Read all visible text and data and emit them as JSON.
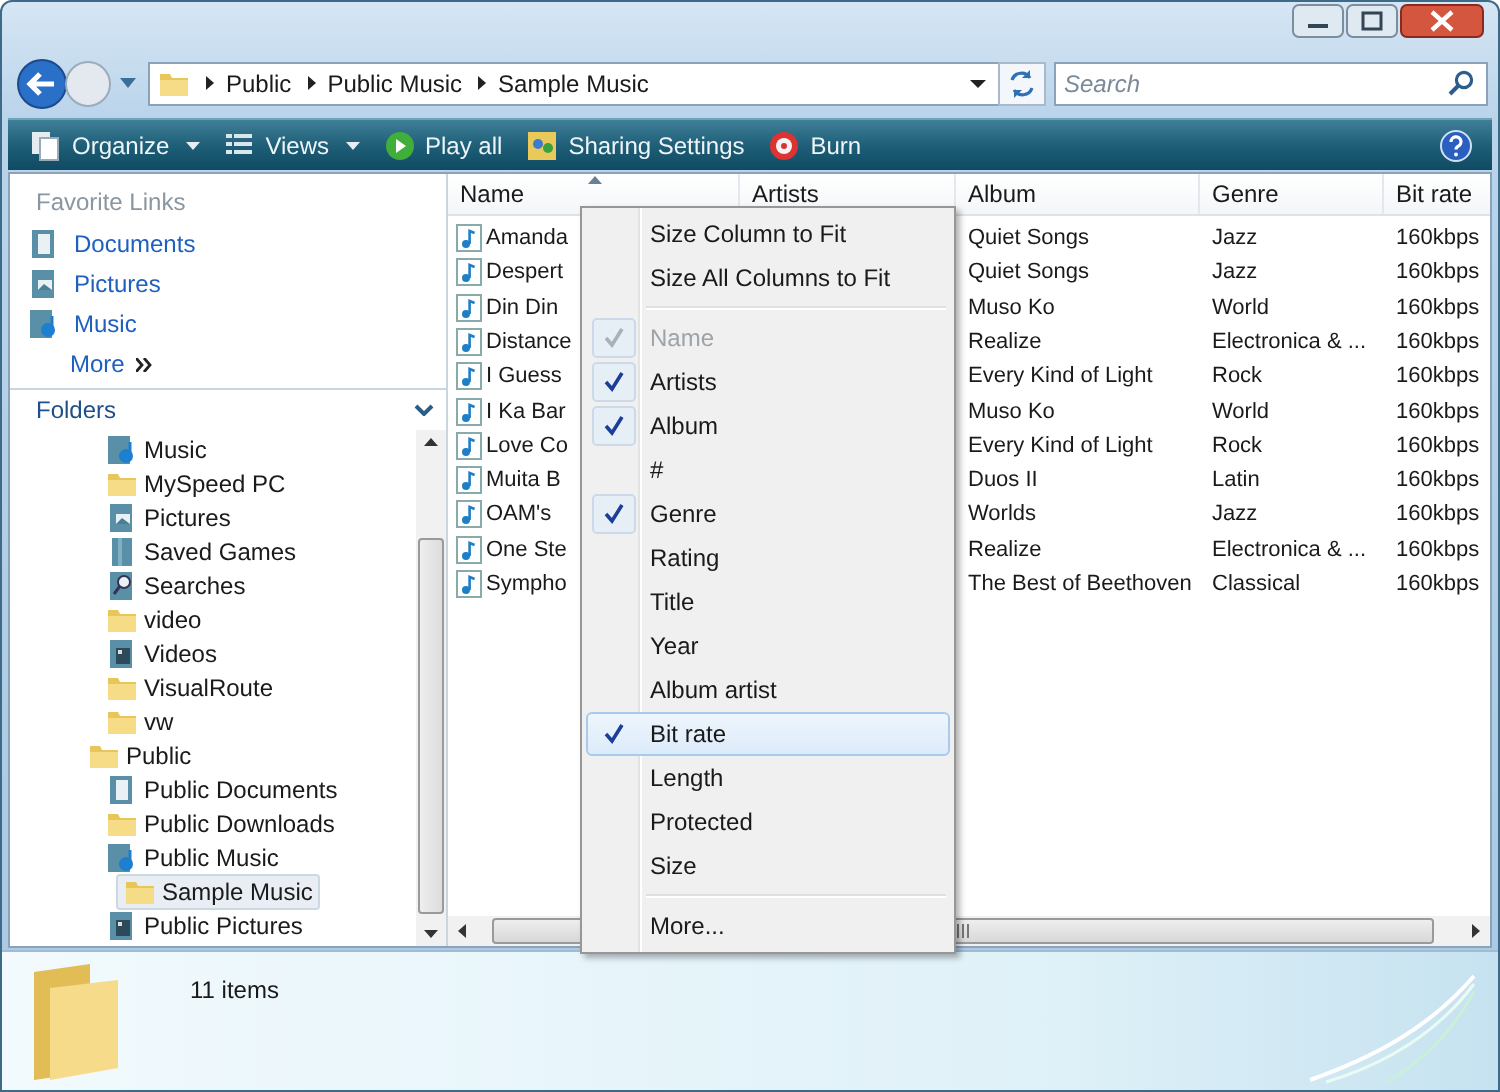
{
  "address_bar": {
    "breadcrumbs": [
      "Public",
      "Public Music",
      "Sample Music"
    ]
  },
  "search": {
    "placeholder": "Search"
  },
  "toolbar": {
    "items": [
      {
        "kind": "organize",
        "label": "Organize",
        "dropdown": true
      },
      {
        "kind": "views",
        "label": "Views",
        "dropdown": true
      },
      {
        "kind": "play",
        "label": "Play all",
        "dropdown": false
      },
      {
        "kind": "sharing",
        "label": "Sharing Settings",
        "dropdown": false
      },
      {
        "kind": "burn",
        "label": "Burn",
        "dropdown": false
      }
    ]
  },
  "navigation": {
    "favorite_links": {
      "title": "Favorite Links",
      "items": [
        {
          "kind": "documents",
          "label": "Documents"
        },
        {
          "kind": "pictures",
          "label": "Pictures"
        },
        {
          "kind": "music",
          "label": "Music"
        }
      ],
      "more": "More"
    },
    "folders": {
      "title": "Folders",
      "tree": [
        {
          "children": [
            {
              "kind": "music",
              "label": "Music",
              "selected": false
            },
            {
              "kind": "folder",
              "label": "MySpeed PC",
              "selected": false
            },
            {
              "kind": "pictures",
              "label": "Pictures",
              "selected": false
            },
            {
              "kind": "games",
              "label": "Saved Games",
              "selected": false
            },
            {
              "kind": "searches",
              "label": "Searches",
              "selected": false
            },
            {
              "kind": "folder",
              "label": "video",
              "selected": false
            },
            {
              "kind": "videos",
              "label": "Videos",
              "selected": false
            },
            {
              "kind": "folder",
              "label": "VisualRoute",
              "selected": false
            },
            {
              "kind": "folder",
              "label": "vw",
              "selected": false
            }
          ]
        },
        {
          "kind": "folder",
          "label": "Public",
          "selected": false,
          "children": [
            {
              "kind": "documents",
              "label": "Public Documents",
              "selected": false
            },
            {
              "kind": "folder",
              "label": "Public Downloads",
              "selected": false
            },
            {
              "kind": "music",
              "label": "Public Music",
              "selected": false,
              "children": [
                {
                  "kind": "folder",
                  "label": "Sample Music",
                  "selected": true
                }
              ]
            },
            {
              "kind": "videos",
              "label": "Public Pictures",
              "selected": false
            }
          ]
        }
      ]
    }
  },
  "file_list": {
    "columns": [
      {
        "label": "Name",
        "sorted": true
      },
      {
        "label": "Artists",
        "sorted": false
      },
      {
        "label": "Album",
        "sorted": false
      },
      {
        "label": "Genre",
        "sorted": false
      },
      {
        "label": "Bit rate",
        "sorted": false
      }
    ],
    "rows": [
      {
        "name": "Amanda",
        "album": "Quiet Songs",
        "genre": "Jazz",
        "bit_rate": "160kbps"
      },
      {
        "name": "Despert",
        "album": "Quiet Songs",
        "genre": "Jazz",
        "bit_rate": "160kbps"
      },
      {
        "name": "Din Din",
        "album": "Muso Ko",
        "genre": "World",
        "bit_rate": "160kbps"
      },
      {
        "name": "Distance",
        "album": "Realize",
        "genre": "Electronica & ...",
        "bit_rate": "160kbps"
      },
      {
        "name": "I Guess",
        "album": "Every Kind of Light",
        "genre": "Rock",
        "bit_rate": "160kbps"
      },
      {
        "name": "I Ka Bar",
        "album": "Muso Ko",
        "genre": "World",
        "bit_rate": "160kbps"
      },
      {
        "name": "Love Co",
        "album": "Every Kind of Light",
        "genre": "Rock",
        "bit_rate": "160kbps"
      },
      {
        "name": "Muita B",
        "album": "Duos II",
        "genre": "Latin",
        "bit_rate": "160kbps"
      },
      {
        "name": "OAM's",
        "album": "Worlds",
        "genre": "Jazz",
        "bit_rate": "160kbps"
      },
      {
        "name": "One Ste",
        "album": "Realize",
        "genre": "Electronica & ...",
        "bit_rate": "160kbps"
      },
      {
        "name": "Sympho",
        "album": "The Best of Beethoven",
        "genre": "Classical",
        "bit_rate": "160kbps"
      }
    ]
  },
  "context_menu": {
    "items": [
      {
        "kind": "command",
        "label": "Size Column to Fit"
      },
      {
        "kind": "command",
        "label": "Size All Columns to Fit"
      },
      {
        "kind": "separator"
      },
      {
        "kind": "column",
        "label": "Name",
        "checked": true,
        "disabled": true,
        "selected": false
      },
      {
        "kind": "column",
        "label": "Artists",
        "checked": true,
        "disabled": false,
        "selected": false
      },
      {
        "kind": "column",
        "label": "Album",
        "checked": true,
        "disabled": false,
        "selected": false
      },
      {
        "kind": "column",
        "label": "#",
        "checked": false,
        "disabled": false,
        "selected": false
      },
      {
        "kind": "column",
        "label": "Genre",
        "checked": true,
        "disabled": false,
        "selected": false
      },
      {
        "kind": "column",
        "label": "Rating",
        "checked": false,
        "disabled": false,
        "selected": false
      },
      {
        "kind": "column",
        "label": "Title",
        "checked": false,
        "disabled": false,
        "selected": false
      },
      {
        "kind": "column",
        "label": "Year",
        "checked": false,
        "disabled": false,
        "selected": false
      },
      {
        "kind": "column",
        "label": "Album artist",
        "checked": false,
        "disabled": false,
        "selected": false
      },
      {
        "kind": "column",
        "label": "Bit rate",
        "checked": true,
        "disabled": false,
        "selected": true
      },
      {
        "kind": "column",
        "label": "Length",
        "checked": false,
        "disabled": false,
        "selected": false
      },
      {
        "kind": "column",
        "label": "Protected",
        "checked": false,
        "disabled": false,
        "selected": false
      },
      {
        "kind": "column",
        "label": "Size",
        "checked": false,
        "disabled": false,
        "selected": false
      },
      {
        "kind": "separator"
      },
      {
        "kind": "command",
        "label": "More..."
      }
    ]
  },
  "status": {
    "count": "11 items"
  }
}
